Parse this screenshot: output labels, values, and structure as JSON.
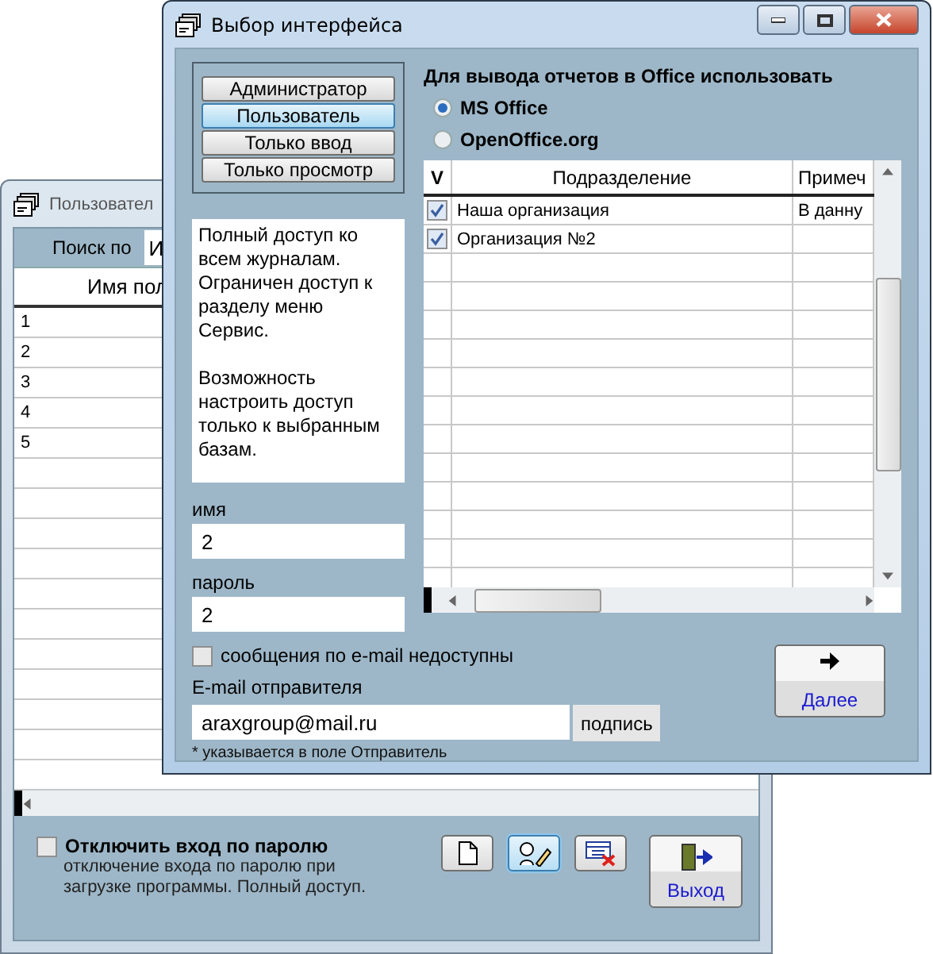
{
  "back_window": {
    "title": "Пользовател",
    "search": {
      "label": "Поиск по",
      "value": "И"
    },
    "table": {
      "columns": [
        "Имя пол"
      ],
      "rows": [
        "1",
        "2",
        "3",
        "4",
        "5"
      ]
    },
    "password_login": {
      "label": "Отключить вход по паролю",
      "checked": false,
      "description": "отключение входа по паролю при загрузке программы. Полный доступ."
    },
    "toolbar": [
      {
        "kind": "new",
        "selected": false
      },
      {
        "kind": "edit",
        "selected": true
      },
      {
        "kind": "delete",
        "selected": false
      }
    ],
    "exit_button": "Выход"
  },
  "dialog": {
    "title": "Выбор интерфейса",
    "roles": [
      {
        "label": "Администратор",
        "selected": false
      },
      {
        "label": "Пользователь",
        "selected": true
      },
      {
        "label": "Только ввод",
        "selected": false
      },
      {
        "label": "Только просмотр",
        "selected": false
      }
    ],
    "description": [
      "Полный доступ ко всем журналам. Ограничен доступ к разделу меню Сервис.",
      "Возможность настроить доступ только к выбранным базам."
    ],
    "name": {
      "label": "имя",
      "value": "2"
    },
    "password": {
      "label": "пароль",
      "value": "2"
    },
    "office": {
      "heading": "Для вывода отчетов в Office использовать",
      "options": [
        {
          "label": "MS Office",
          "selected": true
        },
        {
          "label": "OpenOffice.org",
          "selected": false
        }
      ]
    },
    "table": {
      "check_column": "V",
      "columns": [
        "Подразделение",
        "Примеч"
      ],
      "rows": [
        {
          "checked": true,
          "cells": [
            "Наша организация",
            "В данну"
          ]
        },
        {
          "checked": true,
          "cells": [
            "Организация №2",
            ""
          ]
        }
      ]
    },
    "email_disabled": {
      "label": "сообщения по e-mail недоступны",
      "checked": false
    },
    "sender": {
      "label": "E-mail отправителя",
      "value": "araxgroup@mail.ru",
      "button": "подпись",
      "note": "* указывается в поле Отправитель"
    },
    "next_button": "Далее"
  }
}
